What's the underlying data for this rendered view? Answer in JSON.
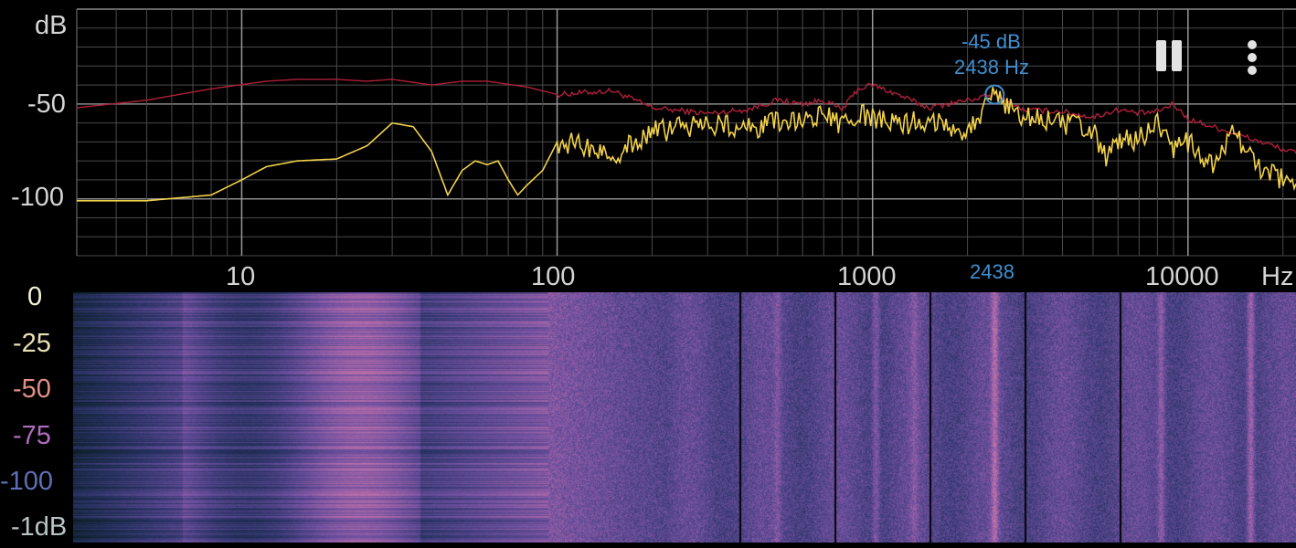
{
  "spectrum": {
    "y_unit": "dB",
    "y_tick_labels": [
      "-50",
      "-100"
    ],
    "x_tick_labels": [
      "10",
      "100",
      "1000",
      "10000"
    ],
    "x_unit": "Hz",
    "peak": {
      "db_label": "-45 dB",
      "hz_label": "2438 Hz",
      "axis_label": "2438",
      "freq_hz": 2438,
      "db": -45
    },
    "colors": {
      "peak_hold": "#b0203a",
      "live": "#f2d24a",
      "peak_marker": "#3f8fd0",
      "grid": "#5a5a5a"
    }
  },
  "chart_data": {
    "type": "line",
    "xscale": "log",
    "xlim": [
      3,
      22000
    ],
    "ylim": [
      -130,
      0
    ],
    "xlabel": "Hz",
    "ylabel": "dB",
    "series": [
      {
        "color": "#b0203a",
        "x": [
          3,
          5,
          8,
          12,
          15,
          20,
          25,
          30,
          40,
          50,
          60,
          80,
          100,
          150,
          200,
          300,
          400,
          500,
          600,
          700,
          800,
          900,
          1000,
          1200,
          1500,
          2000,
          2438,
          3000,
          4000,
          5000,
          6000,
          7000,
          8000,
          9000,
          10000,
          12000,
          15000,
          17000,
          22000
        ],
        "y": [
          -52,
          -48,
          -42,
          -38,
          -37,
          -37,
          -38,
          -37,
          -40,
          -38,
          -38,
          -41,
          -45,
          -43,
          -52,
          -55,
          -53,
          -48,
          -50,
          -48,
          -53,
          -42,
          -40,
          -45,
          -52,
          -48,
          -45,
          -53,
          -54,
          -57,
          -53,
          -55,
          -54,
          -50,
          -58,
          -62,
          -67,
          -70,
          -76
        ]
      },
      {
        "color": "#f2d24a",
        "x": [
          3,
          5,
          8,
          10,
          12,
          15,
          20,
          25,
          30,
          35,
          40,
          45,
          50,
          55,
          60,
          65,
          70,
          75,
          80,
          90,
          100,
          120,
          150,
          200,
          250,
          300,
          400,
          500,
          600,
          700,
          800,
          900,
          1000,
          1200,
          1500,
          2000,
          2438,
          3000,
          4000,
          5000,
          5500,
          6000,
          7000,
          8000,
          9000,
          10000,
          12000,
          14000,
          17000,
          22000
        ],
        "y": [
          -101,
          -101,
          -98,
          -90,
          -83,
          -80,
          -79,
          -72,
          -60,
          -62,
          -75,
          -98,
          -85,
          -80,
          -82,
          -80,
          -90,
          -98,
          -93,
          -85,
          -70,
          -72,
          -77,
          -65,
          -62,
          -60,
          -63,
          -60,
          -58,
          -56,
          -62,
          -55,
          -58,
          -61,
          -58,
          -64,
          -45,
          -57,
          -60,
          -64,
          -80,
          -70,
          -68,
          -60,
          -75,
          -70,
          -84,
          -65,
          -85,
          -92
        ]
      }
    ]
  },
  "spectrogram": {
    "y_tick_labels": [
      "0",
      "-25",
      "-50",
      "-75",
      "-100",
      "-1dB"
    ],
    "y_tick_colors": [
      "#f4f4d8",
      "#e9e0b2",
      "#e28f86",
      "#b06cc0",
      "#5f6fb6",
      "#b9c4c4"
    ]
  },
  "controls": {
    "pause_icon": "pause-icon",
    "menu_icon": "more-vert-icon"
  }
}
